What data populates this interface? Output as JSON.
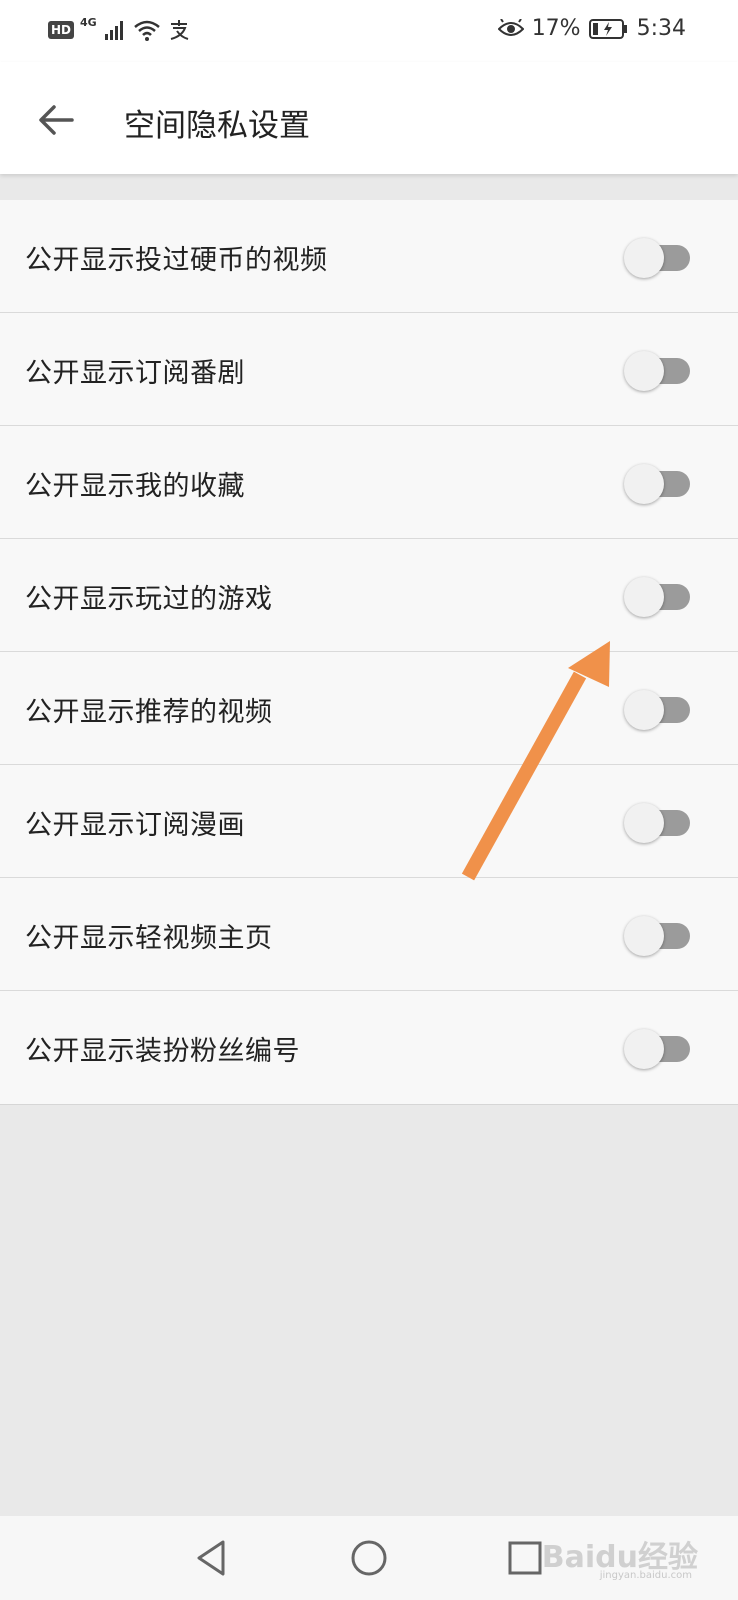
{
  "status_bar": {
    "hd": "HD",
    "network": "4G",
    "battery_percent": "17%",
    "time": "5:34"
  },
  "header": {
    "title": "空间隐私设置"
  },
  "settings": [
    {
      "label": "公开显示投过硬币的视频",
      "on": false
    },
    {
      "label": "公开显示订阅番剧",
      "on": false
    },
    {
      "label": "公开显示我的收藏",
      "on": false
    },
    {
      "label": "公开显示玩过的游戏",
      "on": false
    },
    {
      "label": "公开显示推荐的视频",
      "on": false
    },
    {
      "label": "公开显示订阅漫画",
      "on": false
    },
    {
      "label": "公开显示轻视频主页",
      "on": false
    },
    {
      "label": "公开显示装扮粉丝编号",
      "on": false
    }
  ],
  "watermark": {
    "brand": "Baidu经验",
    "url": "jingyan.baidu.com"
  },
  "colors": {
    "annotation_arrow": "#f0914a",
    "switch_track_off": "#9b9b9b",
    "switch_thumb": "#f1f1f1"
  },
  "icons": {
    "back": "arrow-left-icon",
    "nav_back": "triangle-back-icon",
    "nav_home": "circle-home-icon",
    "nav_recents": "square-recents-icon"
  }
}
